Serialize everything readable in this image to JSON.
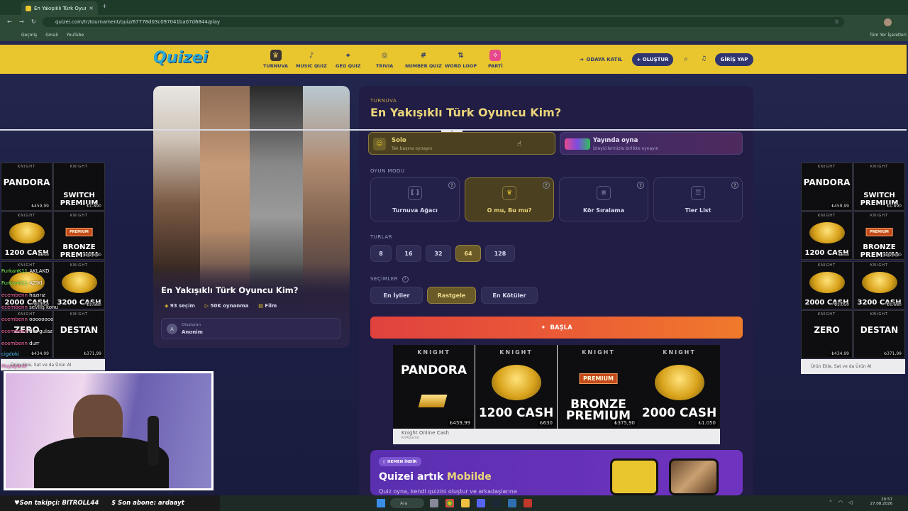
{
  "browser": {
    "tab_title": "En Yakışıklı Türk Oyuncu Kim?",
    "url": "quizei.com/tr/tournament/quiz/67778d03c097041ba07d6844/play",
    "bookmarks": [
      "Geçmiş",
      "Gmail",
      "YouTube"
    ],
    "bookmarks_right": "Tüm Yer İşaretleri"
  },
  "site": {
    "logo": "Quizei",
    "nav": [
      {
        "label": "TURNUVA",
        "icon": "trophy-icon",
        "glyph": "♛"
      },
      {
        "label": "MUSIC QUIZ",
        "icon": "music-icon",
        "glyph": "♪"
      },
      {
        "label": "GEO QUIZ",
        "icon": "map-pin-icon",
        "glyph": "⌖"
      },
      {
        "label": "TRIVIA",
        "icon": "lightbulb-icon",
        "glyph": "◎"
      },
      {
        "label": "NUMBER QUIZ",
        "icon": "hash-icon",
        "glyph": "#"
      },
      {
        "label": "WORD LOOP",
        "icon": "loop-icon",
        "glyph": "⇅"
      },
      {
        "label": "PARTİ",
        "icon": "party-icon",
        "glyph": "✧"
      }
    ],
    "join_room": "ODAYA KATIL",
    "create": "+ OLUŞTUR",
    "login": "GİRİŞ YAP"
  },
  "quiz_card": {
    "title": "En Yakışıklı Türk Oyuncu Kim?",
    "choices": "93 seçim",
    "plays": "50K oynanma",
    "category": "Film",
    "creator_label": "Oluşturan",
    "creator_name": "Anonim",
    "creator_initial": "A"
  },
  "panel": {
    "eyebrow": "TURNUVA",
    "title": "En Yakışıklı Türk Oyuncu Kim?",
    "play_options": [
      {
        "title": "Solo",
        "subtitle": "Tek başına oynayın"
      },
      {
        "title": "Yayında oyna",
        "subtitle": "İzleyicilerinizle birlikte oynayın"
      }
    ],
    "mode_label": "OYUN MODU",
    "modes": [
      "Turnuva Ağacı",
      "O mu, Bu mu?",
      "Kör Sıralama",
      "Tier List"
    ],
    "selected_mode": "O mu, Bu mu?",
    "rounds_label": "TURLAR",
    "rounds": [
      "8",
      "16",
      "32",
      "64",
      "128"
    ],
    "selected_round": "64",
    "selection_label": "SEÇİMLER",
    "selections": [
      "En İyiler",
      "Rastgele",
      "En Kötüler"
    ],
    "selected_selection": "Rastgele",
    "start": "BAŞLA",
    "promo_badge": "HEMEN İNDİR",
    "promo_title_a": "Quizei artık ",
    "promo_title_b": "Mobilde",
    "promo_text": "Quiz oyna, kendi quizini oluştur ve arkadaşlarına"
  },
  "ads": {
    "knight": "KNIGHT",
    "online": "ONLINE",
    "premium": "PREMIUM",
    "center": [
      {
        "name": "PANDORA",
        "price": "₺459,99"
      },
      {
        "name": "1200 CASH",
        "price": "₺630"
      },
      {
        "name": "BRONZE PREMIUM",
        "price": "₺375,90"
      },
      {
        "name": "2000 CASH",
        "price": "₺1.050"
      }
    ],
    "center_footer": "Knight Online Cash",
    "center_footer_sub": "KnRGame",
    "right": [
      {
        "name": "PANDORA",
        "price": "₺459,99"
      },
      {
        "name": "SWITCH PREMIUM",
        "price": "₺1.890"
      },
      {
        "name": "1200 CASH",
        "price": "₺630"
      },
      {
        "name": "BRONZE PREMIUM",
        "price": "₺375,90"
      },
      {
        "name": "2000 CASH",
        "price": "₺1.050"
      },
      {
        "name": "3200 CASH",
        "price": "₺1.680"
      },
      {
        "name": "ZERO",
        "price": "₺434,99"
      },
      {
        "name": "DESTAN",
        "price": "₺371,99"
      }
    ],
    "right_footer": "Ürün Ekle, Sat ve da Ürün Al"
  },
  "chat": [
    {
      "user": "FurkanK11",
      "text": "AKLAKD",
      "color": "#7dff5a"
    },
    {
      "user": "FurkanK11",
      "text": "AZIKİ",
      "color": "#7dff5a"
    },
    {
      "user": "ecembenn",
      "text": "hazırız",
      "color": "#ff6fae"
    },
    {
      "user": "ecembenn",
      "text": "seviliş konu",
      "color": "#ff6fae"
    },
    {
      "user": "ecembenn",
      "text": "oooooooo",
      "color": "#ff6fae"
    },
    {
      "user": "ecembenn",
      "text": "dur gulaz",
      "color": "#ff6fae"
    },
    {
      "user": "ecembenn",
      "text": "durr",
      "color": "#ff6fae"
    },
    {
      "user": "cigdoki",
      "text": "",
      "color": "#5ac8ff"
    },
    {
      "user": "Huyayarer",
      "text": "",
      "color": "#ff66cc"
    }
  ],
  "stream_overlay": {
    "follower": "Son takipçi: BITROLL44",
    "subscriber": "Son abone: ardaayt"
  },
  "taskbar": {
    "search": "Ara",
    "time": "20:57",
    "date": "27.08.2026"
  }
}
